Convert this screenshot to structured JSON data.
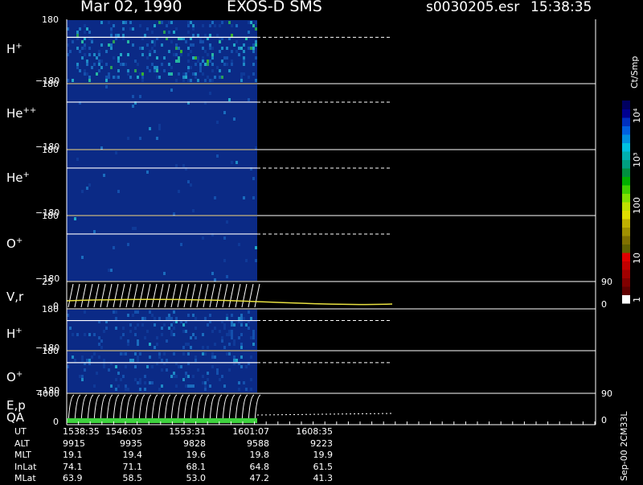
{
  "header": {
    "date": "Mar 02, 1990",
    "instrument": "EXOS-D SMS",
    "file": "s0030205.esr",
    "time": "15:38:35"
  },
  "panels": [
    {
      "label": "H",
      "sup": "+",
      "ytop": "180",
      "ybot": "−180"
    },
    {
      "label": "He",
      "sup": "++",
      "ytop": "180",
      "ybot": "−180"
    },
    {
      "label": "He",
      "sup": "+",
      "ytop": "180",
      "ybot": "−180"
    },
    {
      "label": "O",
      "sup": "+",
      "ytop": "180",
      "ybot": "−180"
    },
    {
      "label": "V,r",
      "sup": "",
      "ytop": "25",
      "ybot": "0",
      "rtop": "90",
      "rbot": "0"
    },
    {
      "label": "H",
      "sup": "+",
      "ytop": "180",
      "ybot": "−180"
    },
    {
      "label": "O",
      "sup": "+",
      "ytop": "180",
      "ybot": "−180"
    },
    {
      "label": "E,p",
      "sup": "",
      "ytop": "4000",
      "ybot": "0",
      "rtop": "90",
      "rbot": "0"
    }
  ],
  "qa_label": "QA",
  "colorbar": {
    "unit": "Ct/Smp",
    "ticks": [
      "1",
      "10",
      "100",
      "10³",
      "10⁴"
    ],
    "colors": [
      "#000060",
      "#000090",
      "#0030c0",
      "#0060e0",
      "#0090e0",
      "#00c0e0",
      "#00b0b0",
      "#00a080",
      "#009040",
      "#00b000",
      "#40d000",
      "#80e000",
      "#c0e000",
      "#e0e000",
      "#c0b000",
      "#a09000",
      "#807000",
      "#606000",
      "#e00000",
      "#c00000",
      "#a00000",
      "#800000",
      "#600000",
      "#ffffff"
    ]
  },
  "colors": {
    "background": "#000000",
    "data_blue": "#0b2a86",
    "qa_bar": "#3ed23e",
    "velocity_curve": "#e8e040"
  },
  "footer": {
    "rows": [
      {
        "label": "UT",
        "values": [
          "1538:35",
          "1546:03",
          "1553:31",
          "1601:07",
          "1608:35"
        ]
      },
      {
        "label": "ALT",
        "values": [
          "9915",
          "9935",
          "9828",
          "9588",
          "9223"
        ]
      },
      {
        "label": "MLT",
        "values": [
          "19.1",
          "19.4",
          "19.6",
          "19.8",
          "19.9"
        ]
      },
      {
        "label": "InLat",
        "values": [
          "74.1",
          "71.1",
          "68.1",
          "64.8",
          "61.5"
        ]
      },
      {
        "label": "MLat",
        "values": [
          "63.9",
          "58.5",
          "53.0",
          "47.2",
          "41.3"
        ]
      }
    ],
    "version": "Sep-00 2CM33L"
  },
  "chart_data": {
    "type": "heatmap",
    "title": "Mar 02, 1990   EXOS-D SMS",
    "x_tick_labels": [
      "1538:35",
      "1546:03",
      "1553:31",
      "1601:07",
      "1608:35"
    ],
    "data_coverage_end_ut": "1601:07",
    "panels": [
      "H+",
      "He++",
      "He+",
      "O+",
      "V,r",
      "H+",
      "O+",
      "E,p"
    ],
    "colorbar": {
      "label": "Ct/Smp",
      "scale": "log",
      "range": [
        1,
        10000
      ]
    }
  }
}
